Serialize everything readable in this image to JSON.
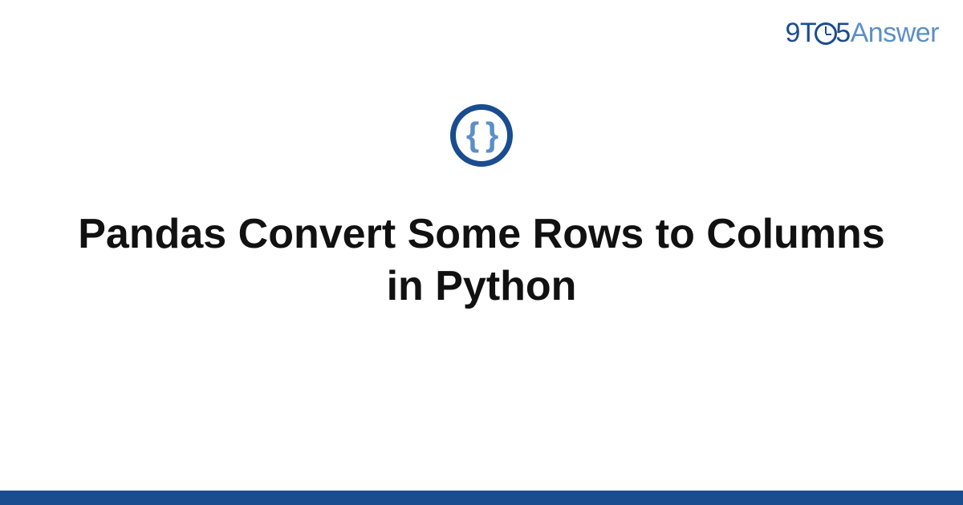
{
  "logo": {
    "part1": "9T",
    "part2": "5",
    "part3": "Answer"
  },
  "icon": {
    "glyph": "{ }"
  },
  "title": "Pandas Convert Some Rows to Columns in Python"
}
